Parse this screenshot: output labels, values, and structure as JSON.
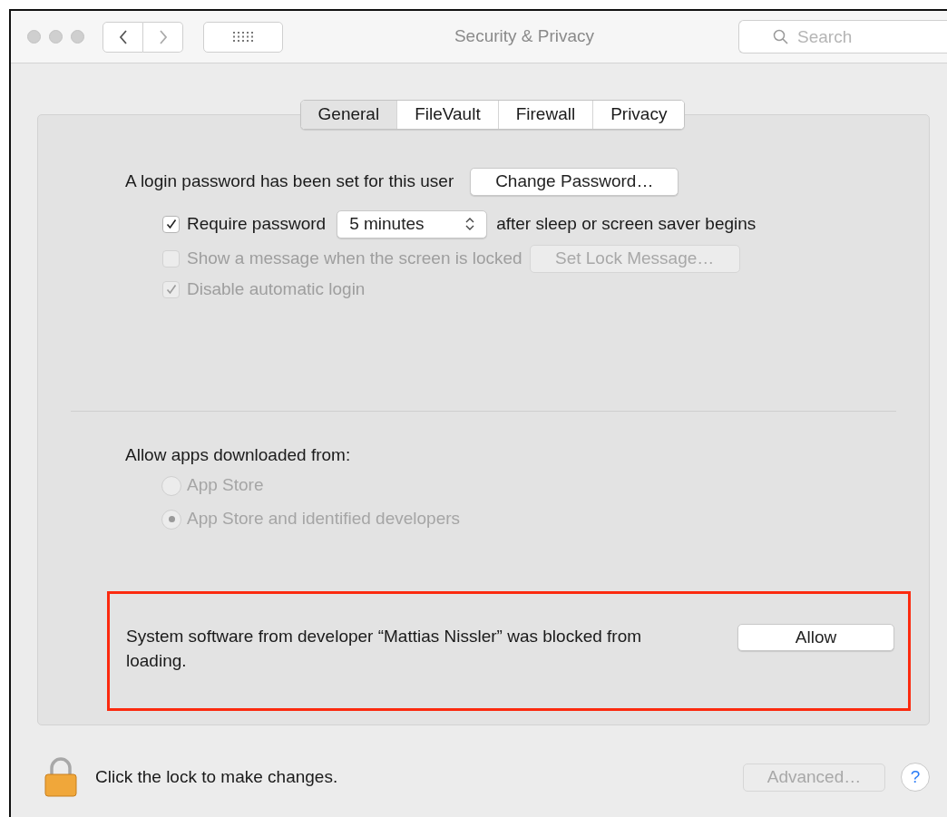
{
  "window": {
    "title": "Security & Privacy"
  },
  "search": {
    "placeholder": "Search"
  },
  "tabs": [
    {
      "label": "General",
      "selected": true
    },
    {
      "label": "FileVault",
      "selected": false
    },
    {
      "label": "Firewall",
      "selected": false
    },
    {
      "label": "Privacy",
      "selected": false
    }
  ],
  "login": {
    "text": "A login password has been set for this user",
    "button": "Change Password…"
  },
  "options": [
    {
      "kind": "select",
      "label": "Require password",
      "checked": true,
      "disabled": false,
      "value": "5 minutes",
      "suffix": "after sleep or screen saver begins"
    },
    {
      "kind": "button",
      "label": "Show a message when the screen is locked",
      "checked": false,
      "disabled": true,
      "button": "Set Lock Message…"
    },
    {
      "kind": "plain",
      "label": "Disable automatic login",
      "checked": true,
      "disabled": true
    }
  ],
  "allow_apps": {
    "heading": "Allow apps downloaded from:",
    "radios": [
      {
        "label": "App Store",
        "selected": false,
        "disabled": true
      },
      {
        "label": "App Store and identified developers",
        "selected": true,
        "disabled": true
      }
    ]
  },
  "notice": {
    "text": "System software from developer “Mattias Nissler” was blocked from loading.",
    "button": "Allow",
    "highlighted": true
  },
  "footer": {
    "lock_text": "Click the lock to make changes.",
    "advanced": {
      "label": "Advanced…",
      "disabled": true
    },
    "help": "?"
  }
}
